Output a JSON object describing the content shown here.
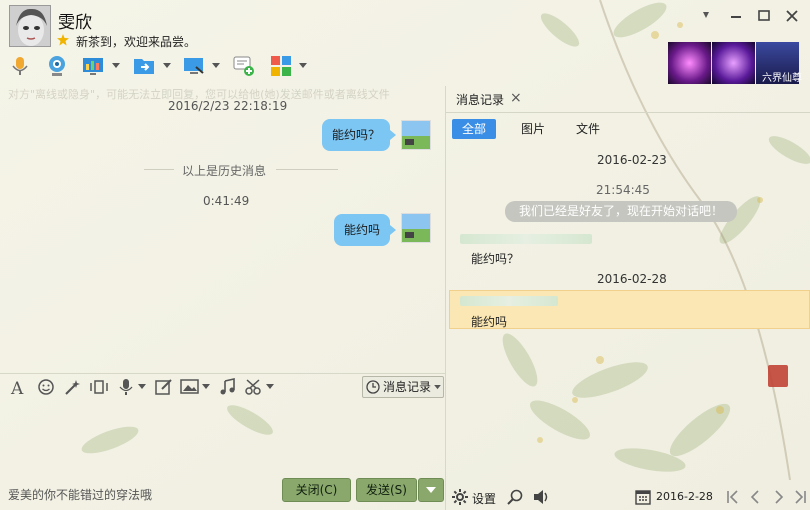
{
  "header": {
    "contact_name": "雯欣",
    "signature": "新茶到，欢迎来品尝。"
  },
  "window_controls": [
    "pin-icon",
    "minimize-icon",
    "maximize-icon",
    "close-icon"
  ],
  "toolbar": {
    "icons": [
      "voice-call-icon",
      "video-call-icon",
      "remote-desktop-icon",
      "file-transfer-icon",
      "screen-share-icon",
      "add-member-icon",
      "apps-icon"
    ]
  },
  "decor": {
    "tile_caption": "六界仙尊"
  },
  "chat": {
    "notice": "对方\"离线或隐身\"，可能无法立即回复，您可以给他(她)发送邮件或者离线文件",
    "time1": "2016/2/23 22:18:19",
    "msg1": "能约吗？",
    "history_divider": "以上是历史消息",
    "time2": "0:41:49",
    "msg2": "能约吗"
  },
  "format_toolbar": {
    "icons": [
      "font-icon",
      "emoji-icon",
      "magic-icon",
      "shake-icon",
      "voice-msg-icon",
      "edit-icon",
      "image-icon",
      "music-icon",
      "scissors-icon"
    ],
    "history_button": "消息记录"
  },
  "footer": {
    "hint": "爱美的你不能错过的穿法哦",
    "close_button": "关闭(C)",
    "send_button": "发送(S)"
  },
  "history_panel": {
    "tab_label": "消息记录",
    "filters": [
      "全部",
      "图片",
      "文件"
    ],
    "date1": "2016-02-23",
    "time1": "21:54:45",
    "system_msg": "我们已经是好友了，现在开始对话吧！",
    "msg1": "能约吗？",
    "date2": "2016-02-28",
    "msg2": "能约吗",
    "settings_label": "设置",
    "current_date": "2016-2-28"
  },
  "colors": {
    "bubble": "#7cc6f3",
    "active_filter": "#3a8ee6",
    "highlight": "#fbe7b3",
    "button": "#8ba86c"
  }
}
